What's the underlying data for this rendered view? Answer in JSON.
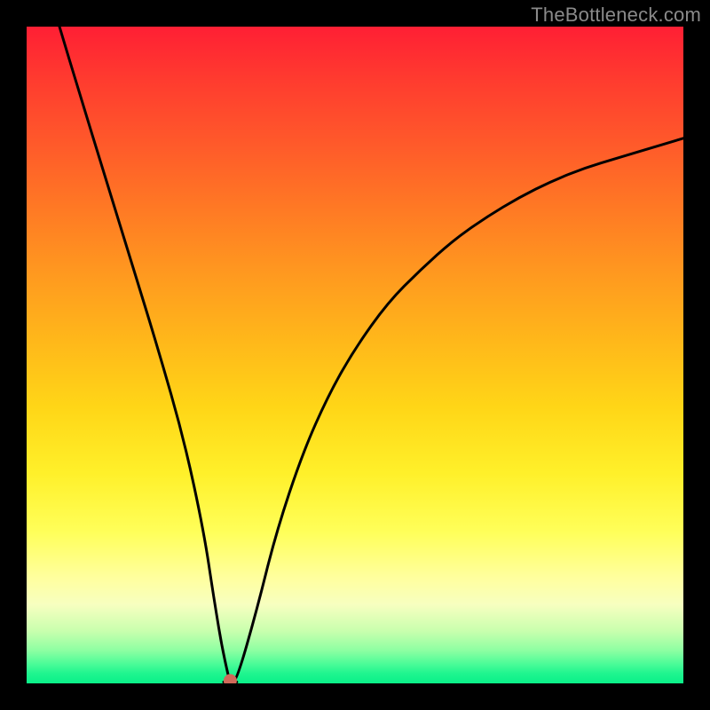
{
  "watermark": "TheBottleneck.com",
  "chart_data": {
    "type": "line",
    "title": "",
    "xlabel": "",
    "ylabel": "",
    "xlim": [
      0,
      100
    ],
    "ylim": [
      0,
      100
    ],
    "grid": false,
    "legend": false,
    "marker": {
      "x": 31,
      "y": 0,
      "color": "#d06a5a"
    },
    "series": [
      {
        "name": "curve",
        "x": [
          5,
          8,
          12,
          16,
          20,
          24,
          27,
          28.5,
          30,
          31,
          32,
          35,
          38,
          42,
          46,
          50,
          55,
          60,
          65,
          70,
          75,
          80,
          85,
          90,
          95,
          100
        ],
        "values": [
          100,
          90,
          77,
          64,
          51,
          37,
          23,
          13,
          4,
          0,
          0.5,
          11,
          23,
          35,
          44,
          51,
          58,
          63,
          67.5,
          71,
          74,
          76.5,
          78.5,
          80,
          81.5,
          83
        ]
      }
    ],
    "background_gradient": {
      "top": "#ff1f34",
      "bottom": "#0af089"
    }
  }
}
